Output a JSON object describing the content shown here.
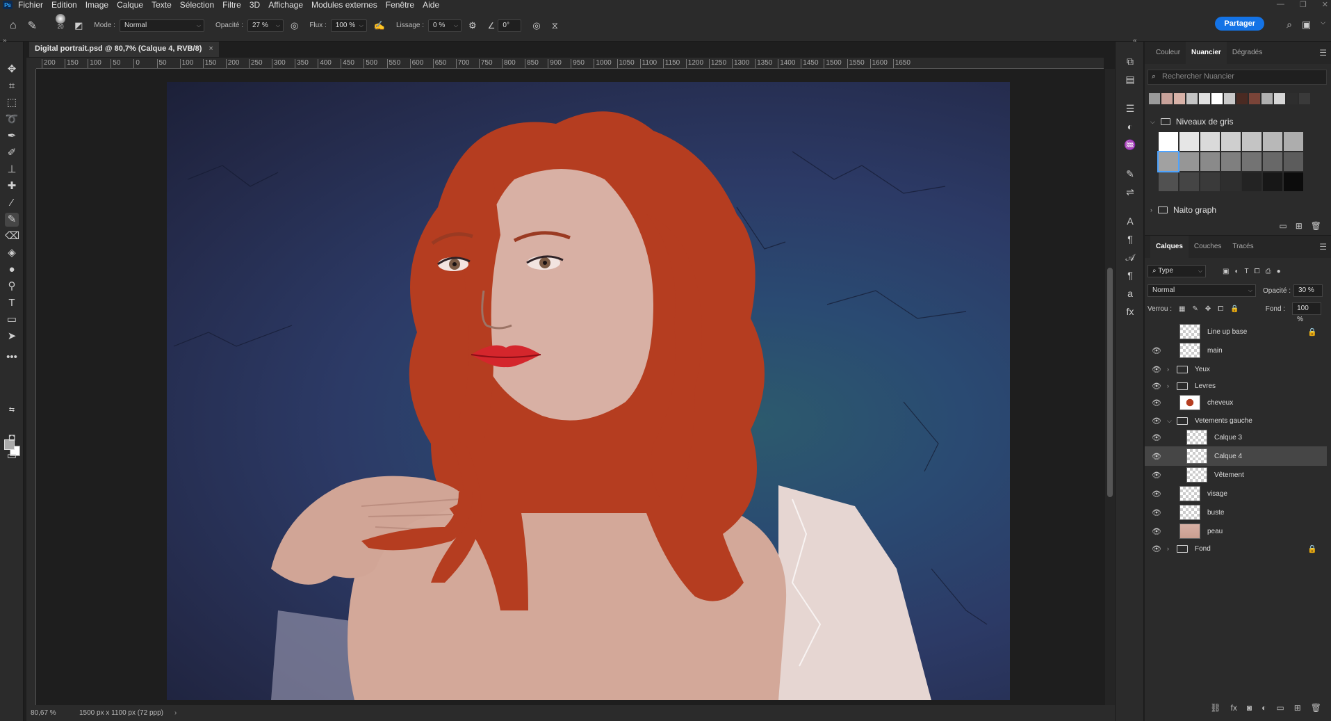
{
  "app": {
    "logo": "Ps"
  },
  "menu": [
    "Fichier",
    "Edition",
    "Image",
    "Calque",
    "Texte",
    "Sélection",
    "Filtre",
    "3D",
    "Affichage",
    "Modules externes",
    "Fenêtre",
    "Aide"
  ],
  "options": {
    "brush_size": "20",
    "mode_label": "Mode :",
    "mode_value": "Normal",
    "opacity_label": "Opacité :",
    "opacity_value": "27 %",
    "flux_label": "Flux :",
    "flux_value": "100 %",
    "lissage_label": "Lissage :",
    "lissage_value": "0 %",
    "angle_value": "0°",
    "share_label": "Partager"
  },
  "document": {
    "tab_title": "Digital portrait.psd @ 80,7% (Calque 4, RVB/8)",
    "close": "×",
    "zoom": "80,67 %",
    "info": "1500 px x 1100 px (72 ppp)"
  },
  "ruler_ticks": [
    "200",
    "150",
    "100",
    "50",
    "0",
    "50",
    "100",
    "150",
    "200",
    "250",
    "300",
    "350",
    "400",
    "450",
    "500",
    "550",
    "600",
    "650",
    "700",
    "750",
    "800",
    "850",
    "900",
    "950",
    "1000",
    "1050",
    "1100",
    "1150",
    "1200",
    "1250",
    "1300",
    "1350",
    "1400",
    "1450",
    "1500",
    "1550",
    "1600",
    "1650"
  ],
  "swatches_panel": {
    "tabs": [
      "Couleur",
      "Nuancier",
      "Dégradés"
    ],
    "active_tab": "Nuancier",
    "search_placeholder": "Rechercher Nuancier",
    "recent_colors": [
      "#9a9a9a",
      "#c8a29a",
      "#d8b2a8",
      "#c4c4c4",
      "#e0e0e0",
      "#ffffff",
      "#c9c9c9",
      "#4a2a22",
      "#7a4438",
      "#b0b0b0",
      "#d6d6d6",
      "#2e2e2e",
      "#3a3a3a"
    ],
    "groups": [
      {
        "name": "Niveaux de gris",
        "expanded": true
      },
      {
        "name": "Naito graph",
        "expanded": false
      }
    ],
    "gray_swatches": [
      "#ffffff",
      "#e6e6e6",
      "#dadada",
      "#cfcfcf",
      "#c4c4c4",
      "#b8b8b8",
      "#adadad",
      "#a1a1a1",
      "#969696",
      "#8a8a8a",
      "#7f7f7f",
      "#737373",
      "#686868",
      "#5c5c5c",
      "#515151",
      "#454545",
      "#3a3a3a",
      "#2e2e2e",
      "#232323",
      "#171717",
      "#0c0c0c"
    ]
  },
  "layers_panel": {
    "tabs": [
      "Calques",
      "Couches",
      "Tracés"
    ],
    "active_tab": "Calques",
    "filter_value": "Type",
    "blend_value": "Normal",
    "opacity_label": "Opacité :",
    "opacity_value": "30 %",
    "lock_label": "Verrou :",
    "fill_label": "Fond :",
    "fill_value": "100 %",
    "layers": [
      {
        "name": "Line up base",
        "visible": false,
        "kind": "layer",
        "locked": true
      },
      {
        "name": "main",
        "visible": true,
        "kind": "layer"
      },
      {
        "name": "Yeux",
        "visible": true,
        "kind": "group"
      },
      {
        "name": "Levres",
        "visible": true,
        "kind": "group"
      },
      {
        "name": "cheveux",
        "visible": true,
        "kind": "layer"
      },
      {
        "name": "Vetements gauche",
        "visible": true,
        "kind": "group-open"
      },
      {
        "name": "Calque 3",
        "visible": true,
        "kind": "layer",
        "indent": true
      },
      {
        "name": "Calque 4",
        "visible": true,
        "kind": "layer",
        "indent": true,
        "selected": true
      },
      {
        "name": "Vêtement",
        "visible": true,
        "kind": "layer",
        "indent": true
      },
      {
        "name": "visage",
        "visible": true,
        "kind": "layer"
      },
      {
        "name": "buste",
        "visible": true,
        "kind": "layer"
      },
      {
        "name": "peau",
        "visible": true,
        "kind": "layer"
      },
      {
        "name": "Fond",
        "visible": true,
        "kind": "group",
        "locked": true
      }
    ]
  },
  "colors": {
    "accent": "#1473e6",
    "hair": "#b53d20",
    "background_navy": "#2a3a66"
  }
}
